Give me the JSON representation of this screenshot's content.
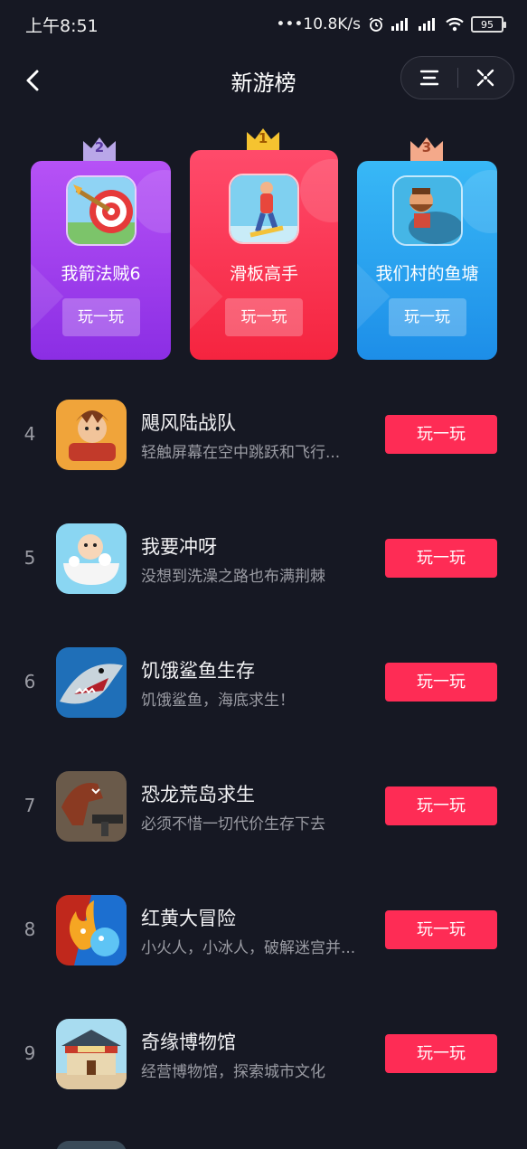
{
  "status": {
    "time": "上午8:51",
    "network": "•••10.8K/s",
    "battery": "95"
  },
  "nav": {
    "title": "新游榜"
  },
  "top3": [
    {
      "rank": "2",
      "name": "我箭法贼6",
      "play": "玩一玩"
    },
    {
      "rank": "1",
      "name": "滑板高手",
      "play": "玩一玩"
    },
    {
      "rank": "3",
      "name": "我们村的鱼塘",
      "play": "玩一玩"
    }
  ],
  "list": [
    {
      "rank": "4",
      "name": "飓风陆战队",
      "desc": "轻触屏幕在空中跳跃和飞行...",
      "play": "玩一玩"
    },
    {
      "rank": "5",
      "name": "我要冲呀",
      "desc": "没想到洗澡之路也布满荆棘",
      "play": "玩一玩"
    },
    {
      "rank": "6",
      "name": "饥饿鲨鱼生存",
      "desc": "饥饿鲨鱼，海底求生！",
      "play": "玩一玩"
    },
    {
      "rank": "7",
      "name": "恐龙荒岛求生",
      "desc": "必须不惜一切代价生存下去",
      "play": "玩一玩"
    },
    {
      "rank": "8",
      "name": "红黄大冒险",
      "desc": "小火人，小冰人，破解迷宫并...",
      "play": "玩一玩"
    },
    {
      "rank": "9",
      "name": "奇缘博物馆",
      "desc": "经营博物馆，探索城市文化",
      "play": "玩一玩"
    }
  ],
  "colors": {
    "background": "#161823",
    "accent": "#fe2c55",
    "card2": "#a63ff0",
    "card1": "#fe2c55",
    "card3": "#2aa8f2"
  },
  "icons": [
    "back-arrow-icon",
    "menu-icon",
    "close-icon",
    "wifi-icon",
    "signal-icon",
    "battery-icon",
    "crown-icon"
  ]
}
